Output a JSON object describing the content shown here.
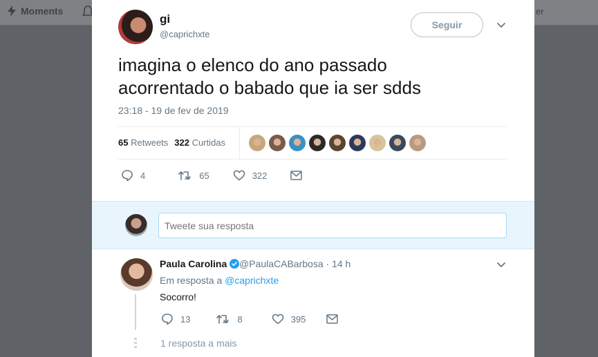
{
  "nav": {
    "moments_label": "Moments",
    "right_fragment": "er"
  },
  "tweet": {
    "name": "gi",
    "handle": "@caprichxte",
    "follow_label": "Seguir",
    "text_line1": "imagina o elenco do ano passado",
    "text_line2": "acorrentado o babado que ia ser sdds",
    "timestamp": "23:18 - 19 de fev de 2019",
    "retweets_count": "65",
    "retweets_label": "Retweets",
    "likes_count": "322",
    "likes_label": "Curtidas",
    "liker_colors": [
      "#c9a67a",
      "#7a5a4a",
      "#3b8fc4",
      "#2a2a2a",
      "#5a4530",
      "#2b3a5c",
      "#d8c39a",
      "#3a4a5a",
      "#b89a80"
    ],
    "actions": {
      "replies": "4",
      "retweets": "65",
      "likes": "322"
    }
  },
  "reply_box": {
    "placeholder": "Tweete sua resposta"
  },
  "reply": {
    "name": "Paula Carolina",
    "meta": "@PaulaCABarbosa · 14 h",
    "replying_prefix": "Em resposta a",
    "replying_to": "@caprichxte",
    "text": "Socorro!",
    "actions": {
      "replies": "13",
      "retweets": "8",
      "likes": "395"
    },
    "more_replies": "1 resposta a mais"
  },
  "colors": {
    "accent": "#1da1f2",
    "muted": "#657786",
    "overlay": "#5f6266"
  }
}
